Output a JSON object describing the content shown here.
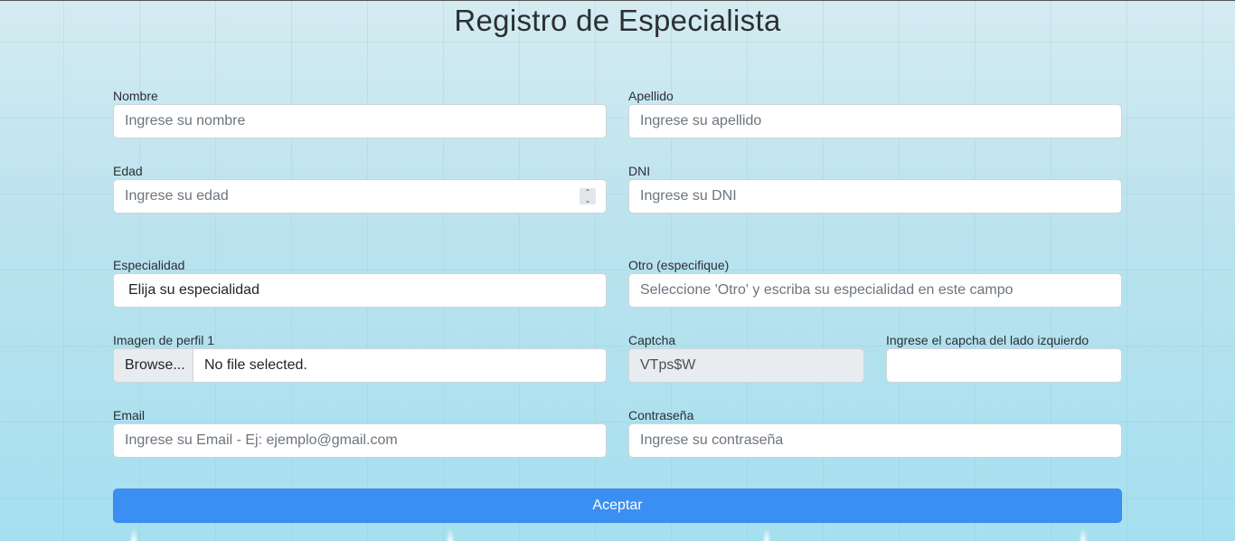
{
  "page": {
    "title": "Registro de Especialista"
  },
  "form": {
    "nombre": {
      "label": "Nombre",
      "placeholder": "Ingrese su nombre"
    },
    "apellido": {
      "label": "Apellido",
      "placeholder": "Ingrese su apellido"
    },
    "edad": {
      "label": "Edad",
      "placeholder": "Ingrese su edad"
    },
    "dni": {
      "label": "DNI",
      "placeholder": "Ingrese su DNI"
    },
    "especialidad": {
      "label": "Especialidad",
      "selected": "Elija su especialidad"
    },
    "otro": {
      "label": "Otro (especifique)",
      "placeholder": "Seleccione 'Otro' y escriba su especialidad en este campo"
    },
    "imagen": {
      "label": "Imagen de perfil 1",
      "button": "Browse...",
      "status": "No file selected."
    },
    "captcha": {
      "label": "Captcha",
      "value": "VTps$W"
    },
    "captcha_input": {
      "label": "Ingrese el capcha del lado izquierdo",
      "placeholder": ""
    },
    "email": {
      "label": "Email",
      "placeholder": "Ingrese su Email - Ej: ejemplo@gmail.com"
    },
    "password": {
      "label": "Contraseña",
      "placeholder": "Ingrese su contraseña"
    },
    "submit": {
      "label": "Aceptar"
    }
  },
  "icons": {
    "number_spinner": "spinner-arrows-icon"
  }
}
